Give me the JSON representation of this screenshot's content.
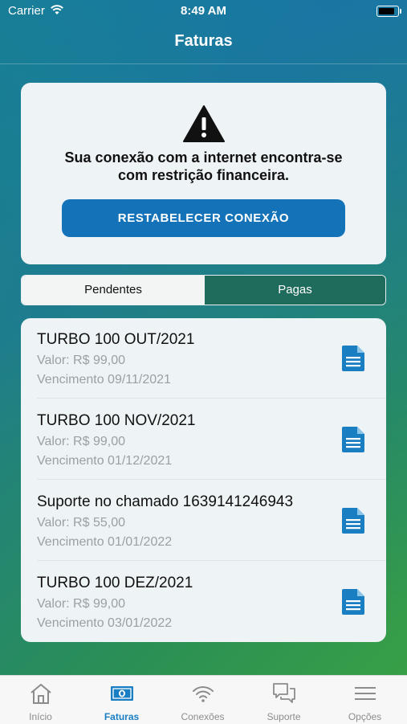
{
  "status_bar": {
    "carrier": "Carrier",
    "time": "8:49 AM"
  },
  "nav": {
    "title": "Faturas"
  },
  "alert": {
    "icon": "warning-icon",
    "message_line1": "Sua conexão com a internet encontra-se",
    "message_line2": "com restrição financeira.",
    "button_label": "RESTABELECER CONEXÃO"
  },
  "segments": {
    "active": "Pendentes",
    "inactive": "Pagas"
  },
  "invoices": [
    {
      "title": "TURBO 100 OUT/2021",
      "value": "Valor: R$ 99,00",
      "due": "Vencimento 09/11/2021"
    },
    {
      "title": "TURBO 100 NOV/2021",
      "value": "Valor: R$ 99,00",
      "due": "Vencimento 01/12/2021"
    },
    {
      "title": "Suporte no chamado 1639141246943",
      "value": "Valor: R$ 55,00",
      "due": "Vencimento 01/01/2022"
    },
    {
      "title": "TURBO 100 DEZ/2021",
      "value": "Valor: R$ 99,00",
      "due": "Vencimento 03/01/2022"
    }
  ],
  "tabs": [
    {
      "label": "Início",
      "icon": "home-icon"
    },
    {
      "label": "Faturas",
      "icon": "money-icon"
    },
    {
      "label": "Conexões",
      "icon": "wifi-icon"
    },
    {
      "label": "Suporte",
      "icon": "chat-icon"
    },
    {
      "label": "Opções",
      "icon": "menu-icon"
    }
  ],
  "colors": {
    "accent": "#1473b8",
    "segment_inactive": "#1f6b5c",
    "tab_active": "#1a7ec2"
  }
}
